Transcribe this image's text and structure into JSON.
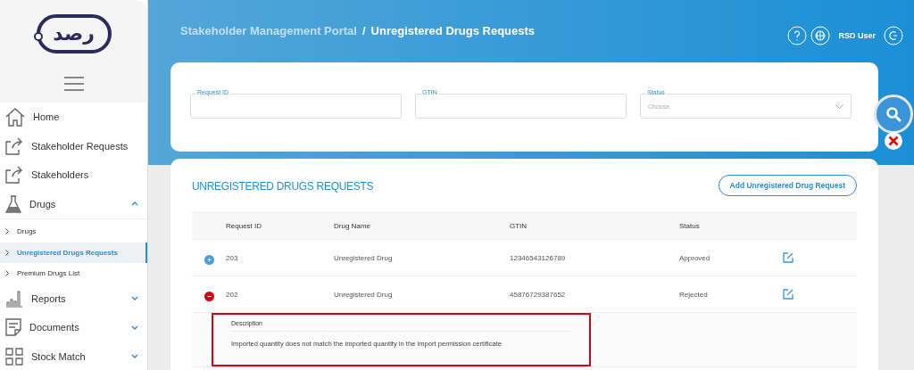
{
  "logo": {
    "text": "رصد"
  },
  "sidebar": {
    "items": [
      {
        "kind": "main",
        "label": "Home"
      },
      {
        "kind": "main",
        "label": "Stakeholder Requests"
      },
      {
        "kind": "main",
        "label": "Stakeholders"
      },
      {
        "kind": "group",
        "label": "Drugs",
        "expanded": true,
        "children": [
          {
            "label": "Drugs",
            "selected": false
          },
          {
            "label": "Unregistered Drugs Requests",
            "selected": true
          },
          {
            "label": "Premium Drugs List",
            "selected": false
          }
        ]
      },
      {
        "kind": "group",
        "label": "Reports",
        "expanded": false
      },
      {
        "kind": "group",
        "label": "Documents",
        "expanded": false
      },
      {
        "kind": "group",
        "label": "Stock Match",
        "expanded": false
      }
    ]
  },
  "header": {
    "breadcrumb": [
      "Stakeholder Management Portal",
      "Unregistered Drugs Requests"
    ],
    "separator": "/",
    "user": "RSD User"
  },
  "filters": [
    {
      "kind": "text",
      "label": "Request ID"
    },
    {
      "kind": "text",
      "label": "GTIN"
    },
    {
      "kind": "select",
      "label": "Status",
      "placeholder": "Choose"
    }
  ],
  "table": {
    "title": "UNREGISTERED DRUGS REQUESTS",
    "add_button": "Add Unregistered Drug Request",
    "columns": [
      "Request ID",
      "Drug Name",
      "GTIN",
      "Status"
    ],
    "rows": [
      {
        "cells": [
          "203",
          "Unregistered Drug",
          "12346543126789",
          "Approved"
        ],
        "expanded": false
      },
      {
        "cells": [
          "202",
          "Unregistered Drug",
          "45876729387652",
          "Rejected"
        ],
        "expanded": true,
        "detail": {
          "label": "Description",
          "text": "Imported quantity does not match the imported quantity in the import permission certificate",
          "highlighted": true
        }
      }
    ]
  }
}
